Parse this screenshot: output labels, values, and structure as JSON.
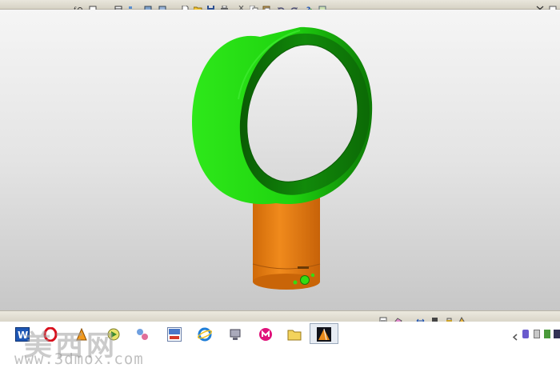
{
  "toolbar_top": {
    "icons": [
      "formula-icon",
      "comment-icon",
      "table-icon",
      "tree-icon",
      "view-icon",
      "new-file-icon",
      "open-folder-icon",
      "save-icon",
      "print-icon",
      "cut-icon",
      "copy-icon",
      "paste-icon",
      "undo-icon",
      "redo-icon",
      "help-icon",
      "close-window-icon"
    ]
  },
  "viewport": {
    "model": "bladeless-fan",
    "colors": {
      "ring": "#22dd11",
      "ring_dark": "#0b6a06",
      "base": "#e37a10",
      "button": "#33dd11"
    }
  },
  "toolbar_bottom": {
    "icons": [
      "swap-icon",
      "erase-icon",
      "resize-icon",
      "material-icon",
      "lock-icon",
      "render-icon"
    ]
  },
  "taskbar": {
    "apps": [
      "word-icon",
      "opera-icon",
      "paint-icon",
      "media-icon",
      "pdf-icon",
      "ie-icon",
      "network-icon",
      "media-player-icon",
      "folder-icon",
      "catia-icon"
    ],
    "active_index": 9
  },
  "watermark": {
    "chinese": "美西网",
    "url": "www.3dmox.com"
  }
}
